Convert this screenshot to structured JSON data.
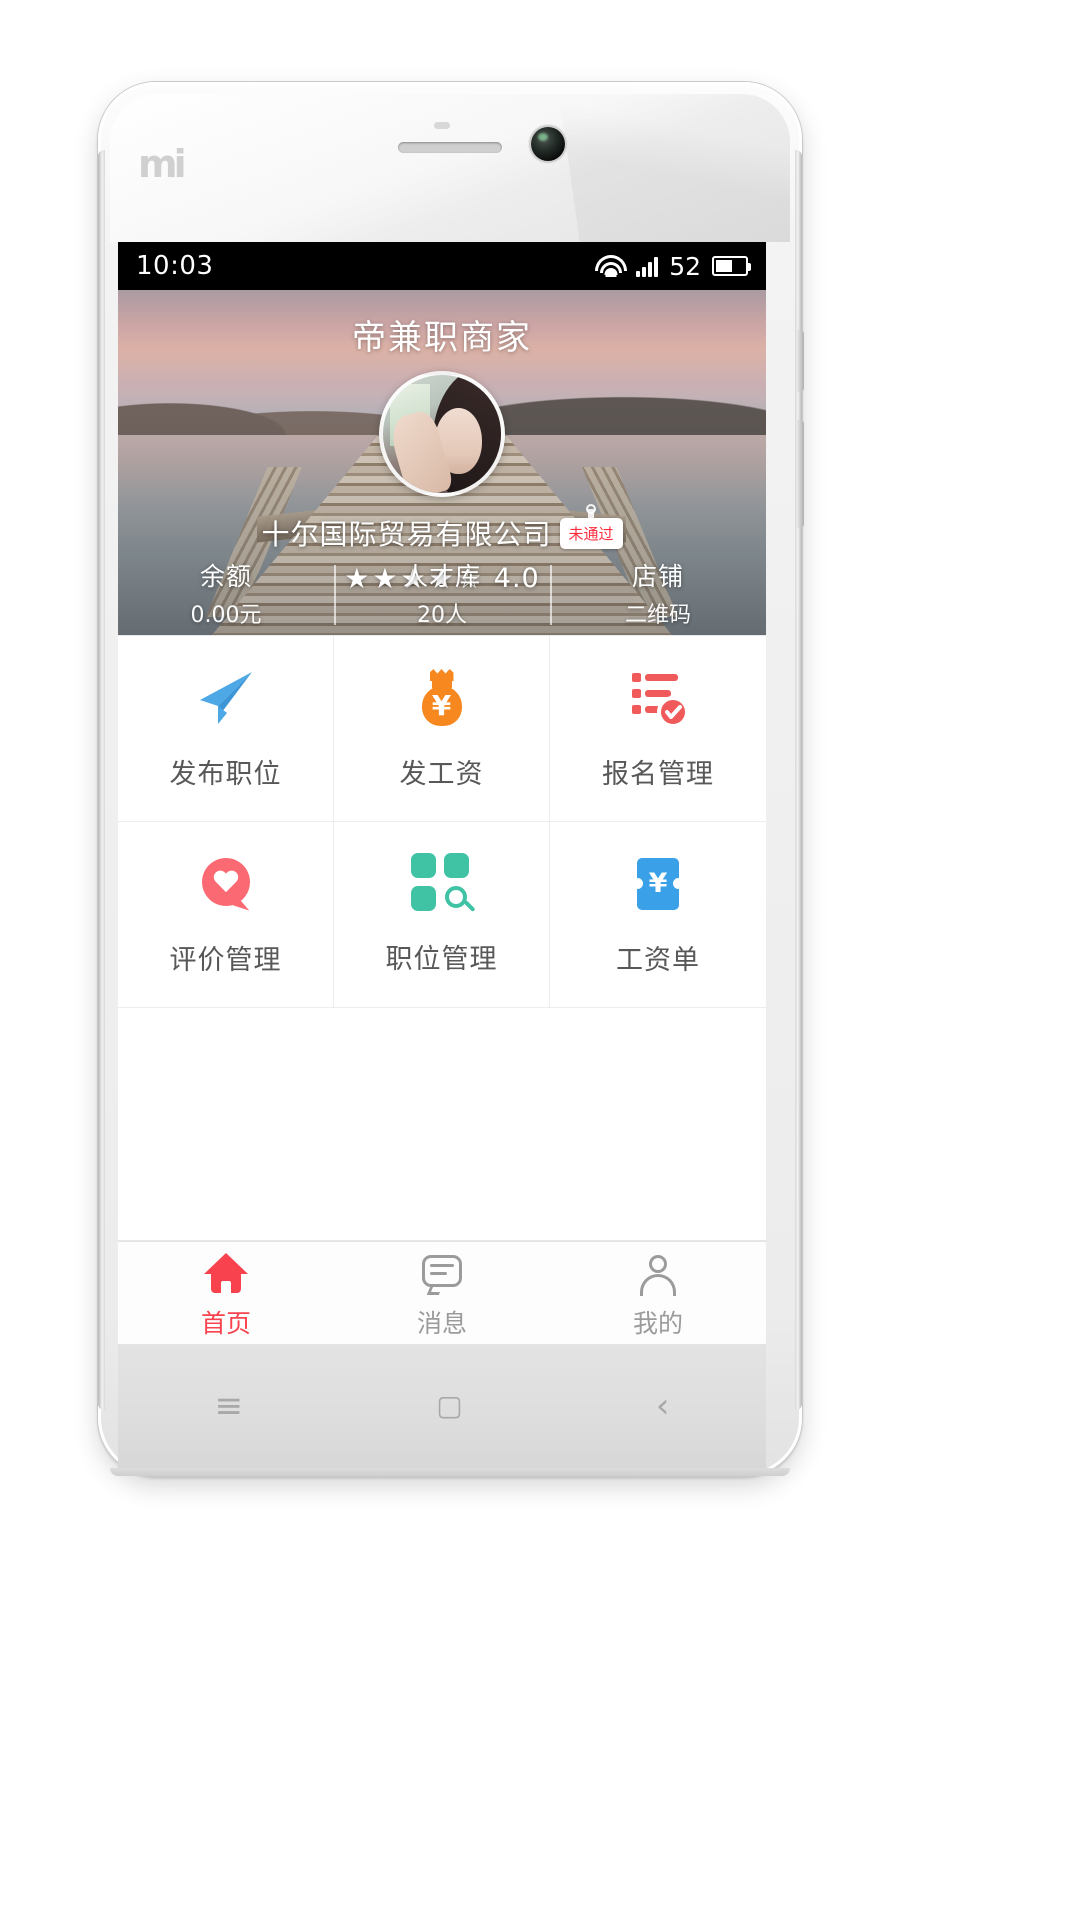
{
  "status_bar": {
    "time": "10:03",
    "wifi_icon": "wifi-icon",
    "signal_icon": "signal-bars-icon",
    "battery_percent": "52",
    "battery_icon": "battery-icon"
  },
  "header": {
    "app_title": "帝兼职商家",
    "avatar_alt": "user-avatar",
    "company_name": "十尔国际贸易有限公司",
    "verify_badge": "未通过",
    "rating_value": "4.0",
    "stars_filled": 4,
    "stars_total": 5,
    "star_filled_glyph": "★",
    "star_empty_glyph": "☆",
    "stats": [
      {
        "label": "余额",
        "value": "0.00元"
      },
      {
        "label": "人才库",
        "value": "20人"
      },
      {
        "label": "店铺",
        "value": "二维码"
      }
    ]
  },
  "grid_menu": [
    {
      "label": "发布职位",
      "icon": "paper-plane-icon",
      "color": "#46a3e0"
    },
    {
      "label": "发工资",
      "icon": "money-bag-icon",
      "color": "#f7881f"
    },
    {
      "label": "报名管理",
      "icon": "signup-list-icon",
      "color": "#f05a5a"
    },
    {
      "label": "评价管理",
      "icon": "heart-bubble-icon",
      "color": "#fb6a73"
    },
    {
      "label": "职位管理",
      "icon": "grid-search-icon",
      "color": "#40c3a4"
    },
    {
      "label": "工资单",
      "icon": "payslip-card-icon",
      "color": "#3aa0e8"
    }
  ],
  "tab_bar": {
    "active_color": "#f8434f",
    "inactive_color": "#9b9b9b",
    "tabs": [
      {
        "label": "首页",
        "icon": "home-icon",
        "active": true
      },
      {
        "label": "消息",
        "icon": "message-icon",
        "active": false
      },
      {
        "label": "我的",
        "icon": "person-icon",
        "active": false
      }
    ]
  },
  "android_nav": {
    "menu": "≡",
    "home": "▢",
    "back": "‹"
  },
  "device": {
    "brand_logo": "mi"
  }
}
